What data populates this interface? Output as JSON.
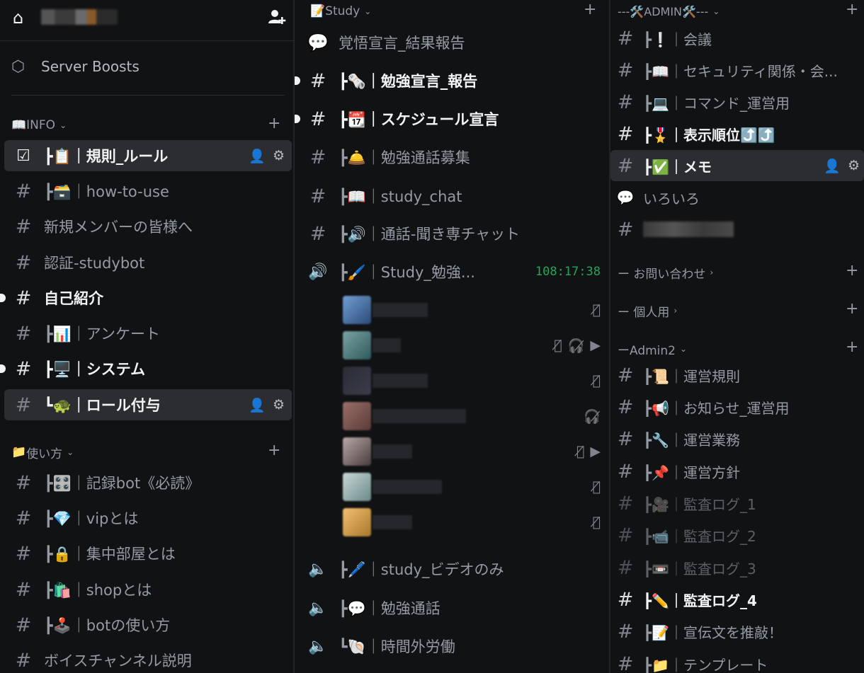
{
  "colors": {
    "bg": "#111214",
    "selected": "#2b2d31",
    "text_bright": "#f2f3f5",
    "text_muted": "#949ba4",
    "voice_active": "#23a55a"
  },
  "col1": {
    "boost_label": "Server Boosts",
    "categories": {
      "info": "INFO",
      "usage": "使い方"
    },
    "channels": [
      {
        "label": "┣📋｜規則_ルール"
      },
      {
        "label": "┣🗃️｜how-to-use"
      },
      {
        "label": "新規メンバーの皆様へ"
      },
      {
        "label": "認証-studybot"
      },
      {
        "label": "自己紹介"
      },
      {
        "label": "┣📊｜アンケート"
      },
      {
        "label": "┣🖥️｜システム"
      },
      {
        "label": "┗🐢｜ロール付与"
      },
      {
        "label": "┣🎛️｜記録bot《必読》"
      },
      {
        "label": "┣💎｜vipとは"
      },
      {
        "label": "┣🔒｜集中部屋とは"
      },
      {
        "label": "┣🛍️｜shopとは"
      },
      {
        "label": "┣🕹️｜botの使い方"
      },
      {
        "label": "ボイスチャンネル説明"
      }
    ]
  },
  "col2": {
    "category": "📝Study",
    "channels": [
      {
        "label": "覚悟宣言_結果報告"
      },
      {
        "label": "┣🗞️｜勉強宣言_報告"
      },
      {
        "label": "┣📆｜スケジュール宣言"
      },
      {
        "label": "┣🛎️｜勉強通話募集"
      },
      {
        "label": "┣📖｜study_chat"
      },
      {
        "label": "┣🔊｜通話-聞き専チャット"
      },
      {
        "label": "┣🖌️｜Study_勉強..."
      },
      {
        "label": "┣🖊️｜study_ビデオのみ"
      },
      {
        "label": "┣💬｜勉強通話"
      },
      {
        "label": "┗🐚｜時間外労働"
      }
    ],
    "voice_timer": "108:17:38"
  },
  "col3": {
    "categories": {
      "admin": "---🛠️ADMIN🛠️---",
      "contact": "ー お問い合わせ",
      "personal": "ー 個人用",
      "admin2": "ーAdmin2"
    },
    "channels": [
      {
        "label": "┣❕｜会議"
      },
      {
        "label": "┣📖｜セキュリティ関係・会..."
      },
      {
        "label": "┣💻｜コマンド_運営用"
      },
      {
        "label": "┣🎖️｜表示順位⤴️⤴️"
      },
      {
        "label": "┣✅｜メモ"
      },
      {
        "label": "いろいろ"
      },
      {
        "label": "┣📜｜運営規則"
      },
      {
        "label": "┣📢｜お知らせ_運営用"
      },
      {
        "label": "┣🔧｜運営業務"
      },
      {
        "label": "┣📌｜運営方針"
      },
      {
        "label": "┣🎥｜監査ログ_1"
      },
      {
        "label": "┣📹｜監査ログ_2"
      },
      {
        "label": "┣📼｜監査ログ_3"
      },
      {
        "label": "┣✏️｜監査ログ_4"
      },
      {
        "label": "┣📝｜宣伝文を推敲！"
      },
      {
        "label": "┣📁｜テンプレート"
      }
    ]
  }
}
